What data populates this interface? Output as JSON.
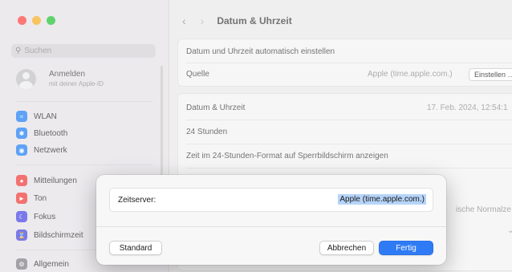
{
  "window": {
    "colors": {
      "close": "#fc5b57",
      "minimize": "#f6b73c",
      "maximize": "#3ec84e"
    }
  },
  "sidebar": {
    "search_placeholder": "Suchen",
    "account": {
      "name": "Anmelden",
      "subtitle": "mit deiner Apple-ID"
    },
    "items": [
      {
        "label": "WLAN",
        "icon": "wifi-icon",
        "color": "#3b8ef5"
      },
      {
        "label": "Bluetooth",
        "icon": "bluetooth-icon",
        "color": "#3b8ef5"
      },
      {
        "label": "Netzwerk",
        "icon": "globe-icon",
        "color": "#3b8ef5"
      },
      {
        "label": "Mitteilungen",
        "icon": "bell-icon",
        "color": "#ef5350"
      },
      {
        "label": "Ton",
        "icon": "speaker-icon",
        "color": "#ef5350"
      },
      {
        "label": "Fokus",
        "icon": "moon-icon",
        "color": "#5e5ce6"
      },
      {
        "label": "Bildschirmzeit",
        "icon": "hourglass-icon",
        "color": "#5e5ce6"
      },
      {
        "label": "Allgemein",
        "icon": "gear-icon",
        "color": "#8e8e93"
      }
    ]
  },
  "main": {
    "title": "Datum & Uhrzeit",
    "rows": {
      "auto_label": "Datum und Uhrzeit automatisch einstellen",
      "source_label": "Quelle",
      "source_value": "Apple (time.apple.com.)",
      "source_button": "Einstellen …",
      "datetime_label": "Datum & Uhrzeit",
      "datetime_value": "17. Feb. 2024, 12:54:1",
      "h24_label": "24 Stunden",
      "lock_label": "Zeit im 24-Stunden-Format auf Sperrbildschirm anzeigen",
      "partial_value": "ische Normalze"
    }
  },
  "dialog": {
    "field_label": "Zeitserver:",
    "field_value": "Apple (time.apple.com.)",
    "standard_button": "Standard",
    "cancel_button": "Abbrechen",
    "done_button": "Fertig"
  }
}
